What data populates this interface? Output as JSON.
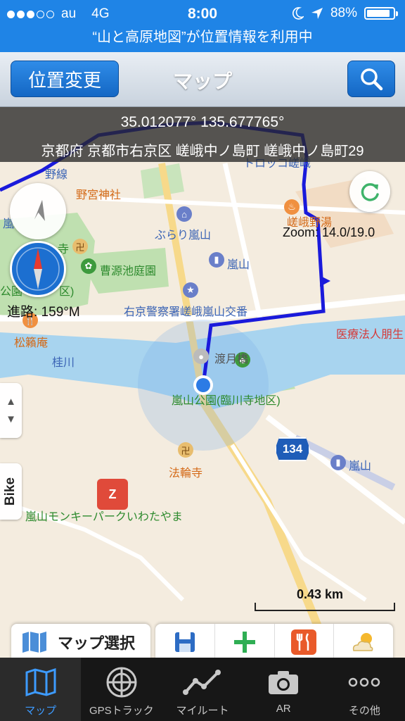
{
  "status_bar": {
    "carrier": "au",
    "network": "4G",
    "time": "8:00",
    "battery_percent": "88%",
    "battery_level": 0.88,
    "signal_bars_filled": 3,
    "signal_bars_total": 5
  },
  "location_banner": "“山と高原地図”が位置情報を利用中",
  "nav": {
    "relocate_label": "位置変更",
    "title": "マップ",
    "search_icon": "search-icon"
  },
  "map": {
    "coordinates": "35.012077° 135.677765°",
    "address": "京都府 京都市右京区 嵯峨中ノ島町 嵯峨中ノ島町29",
    "heading": "進路: 159°M",
    "zoom": "Zoom: 14.0/19.0",
    "scale": "0.43 km",
    "labels": {
      "torokko": "トロッコ嵯峨",
      "nonomiya": "野宮神社",
      "burari": "ぶらり嵐山",
      "sagano_yu": "嵯峨野湯",
      "ransan_1": "嵐",
      "ransan_2": "嵐山",
      "temple_partial": "寺",
      "sogenchi": "曹源池庭園",
      "park_partial": "公園",
      "park_partial_2": "区)",
      "police": "右京警察署嵯峨嵐山交番",
      "hospital": "医療法人朋生",
      "shoraian": "松籟庵",
      "katsuragawa": "桂川",
      "togetsukyo": "渡月橋",
      "arashiyama_park": "嵐山公園(臨川寺地区)",
      "route_134": "134",
      "ransan_station": "嵐山",
      "horinji": "法輪寺",
      "monkey_park": "嵐山モンキーパークいわたやま",
      "rail_partial": "野線"
    }
  },
  "bike_label": "Bike",
  "map_select_label": "マップ選択",
  "tools": [
    "save-icon",
    "add-icon",
    "restaurant-icon",
    "weather-icon"
  ],
  "tabs": [
    {
      "label": "マップ",
      "icon": "map-icon",
      "active": true
    },
    {
      "label": "GPSトラック",
      "icon": "gps-track-icon",
      "active": false
    },
    {
      "label": "マイルート",
      "icon": "my-route-icon",
      "active": false
    },
    {
      "label": "AR",
      "icon": "camera-icon",
      "active": false
    },
    {
      "label": "その他",
      "icon": "more-icon",
      "active": false
    }
  ],
  "colors": {
    "status_blue": "#1f84e6",
    "route_blue": "#1a1adb",
    "water": "#a8d4ef",
    "park": "#bfe0b0",
    "active_tab": "#3d9bff"
  }
}
